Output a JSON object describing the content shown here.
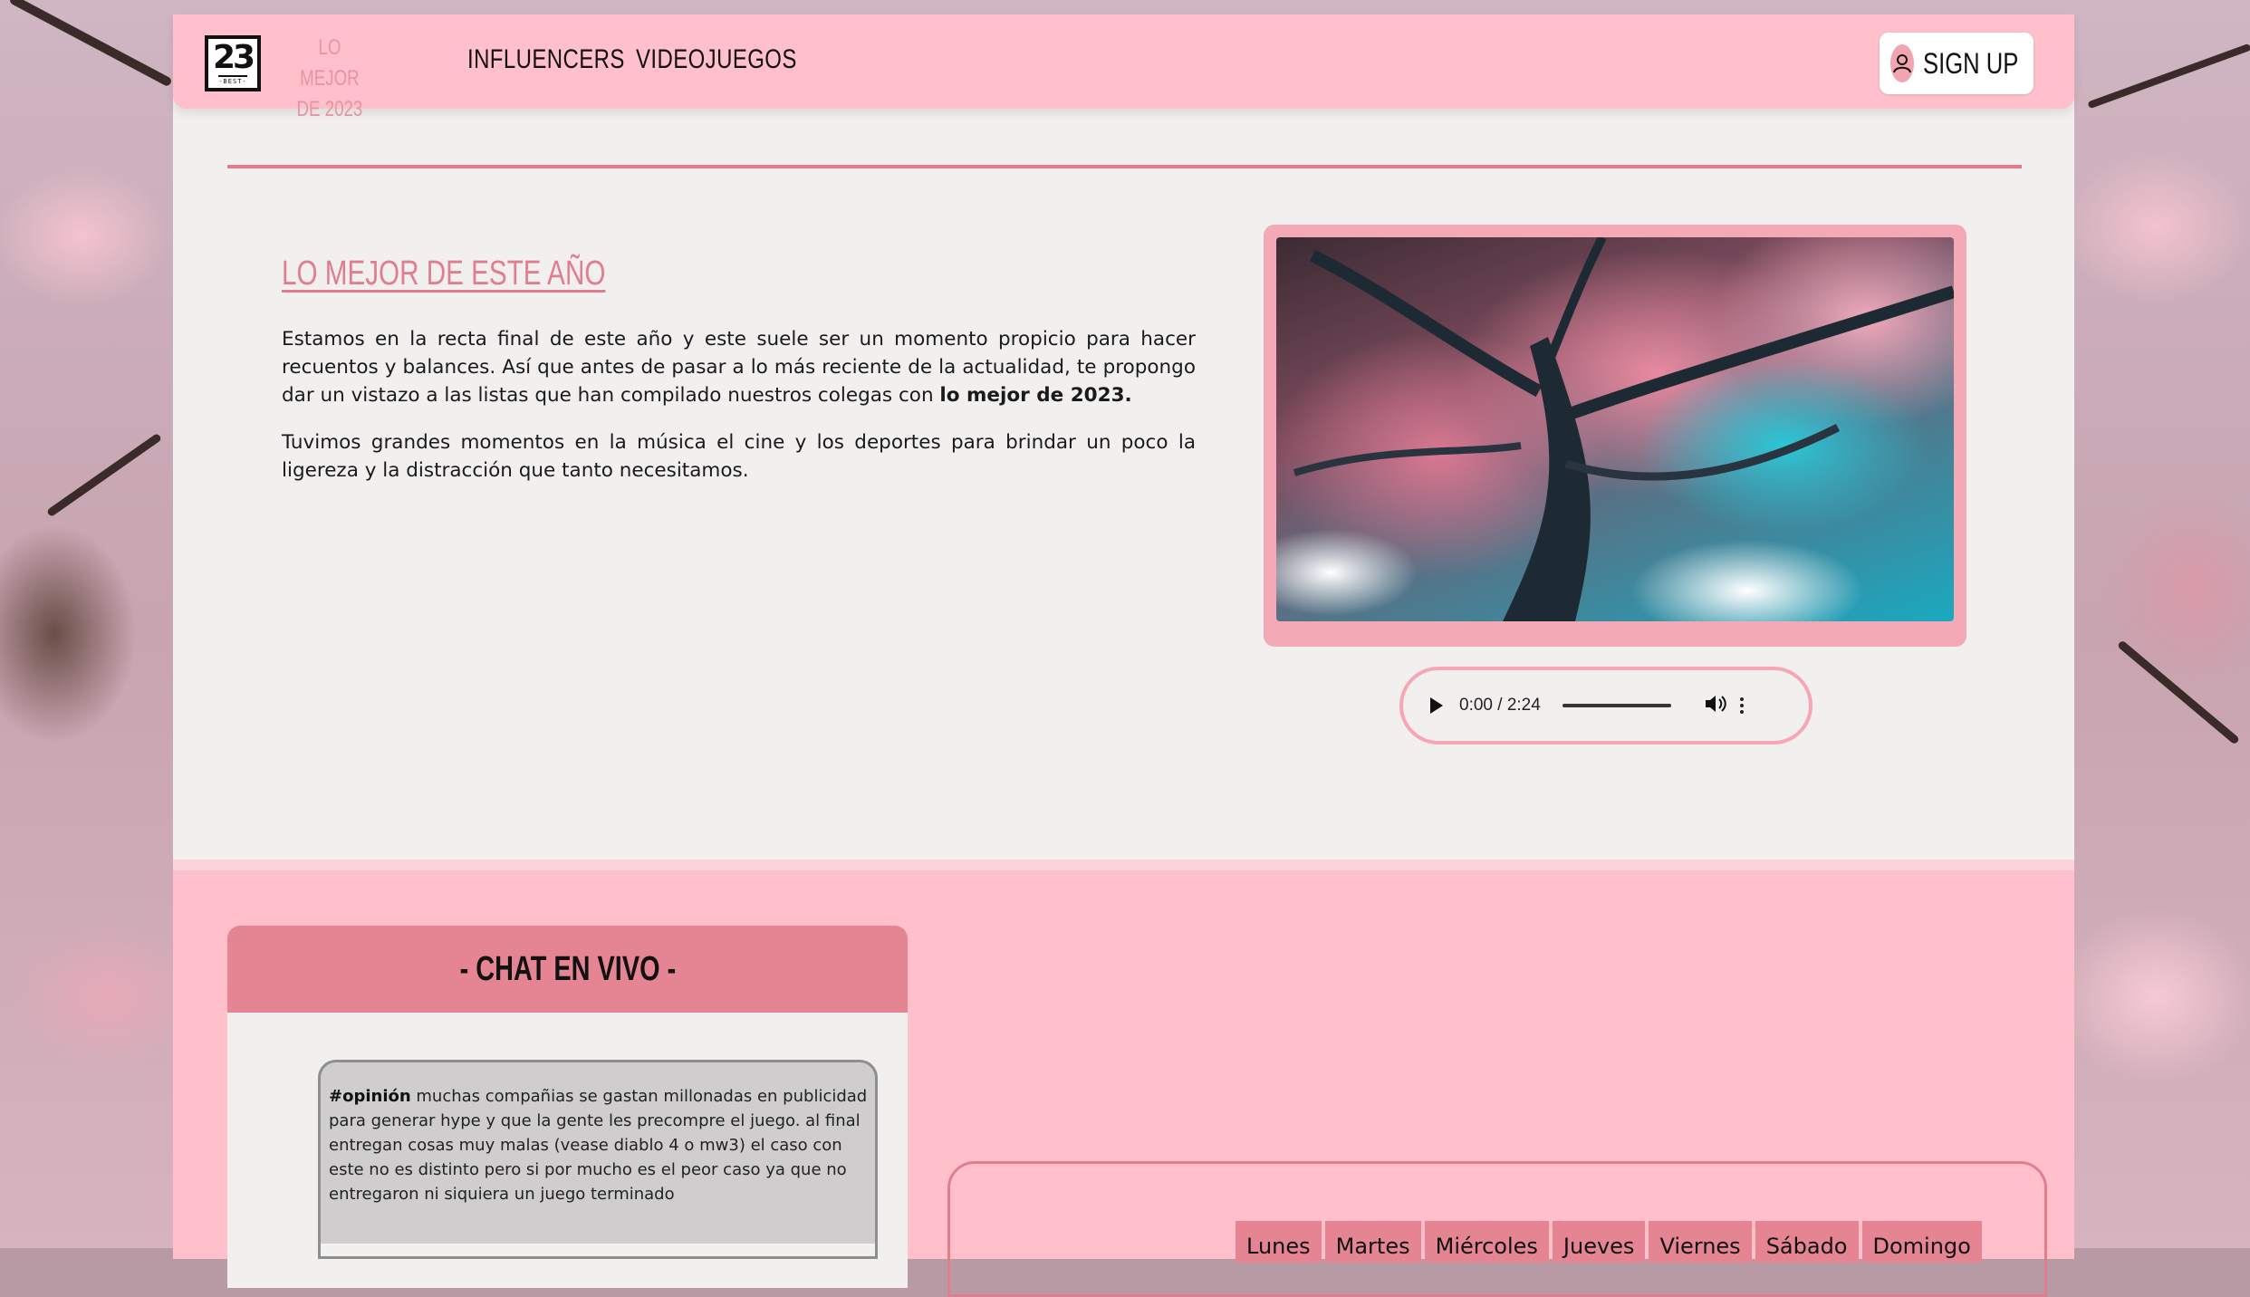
{
  "brand": {
    "logo_number": "23",
    "logo_sub": "-BEST-",
    "line1": "LO MEJOR",
    "line2": "DE 2023"
  },
  "nav": {
    "links": [
      "INFLUENCERS",
      "VIDEOJUEGOS"
    ],
    "signup_label": "SIGN UP"
  },
  "article": {
    "title": "LO MEJOR DE ESTE AÑO",
    "para1_text": "Estamos en la recta final de este año y este suele ser un momento propicio para hacer recuentos y balances. Así que antes de pasar a lo más reciente de la actualidad, te propongo dar un vistazo a las listas que han compilado nuestros colegas con ",
    "para1_bold": "lo mejor de 2023.",
    "para2": "Tuvimos grandes momentos en la música el cine y los deportes para brindar un poco la ligereza y la distracción que tanto necesitamos."
  },
  "audio": {
    "time": "0:00 / 2:24"
  },
  "chat": {
    "title": "- CHAT EN VIVO -",
    "message_tag": "#opinión",
    "message_text": " muchas compañias se gastan millonadas en publicidad para generar hype y que la gente les precompre el juego. al final entregan cosas muy malas (vease diablo 4 o mw3) el caso con este no es distinto pero si por mucho es el peor caso ya que no entregaron ni siquiera un juego terminado"
  },
  "schedule": {
    "days": [
      "Lunes",
      "Martes",
      "Miércoles",
      "Jueves",
      "Viernes",
      "Sábado",
      "Domingo"
    ]
  },
  "colors": {
    "nav_bg": "#ffc0cb",
    "accent": "#e17e8e",
    "chat_header": "#e58593",
    "page_bg": "#f2efef"
  }
}
